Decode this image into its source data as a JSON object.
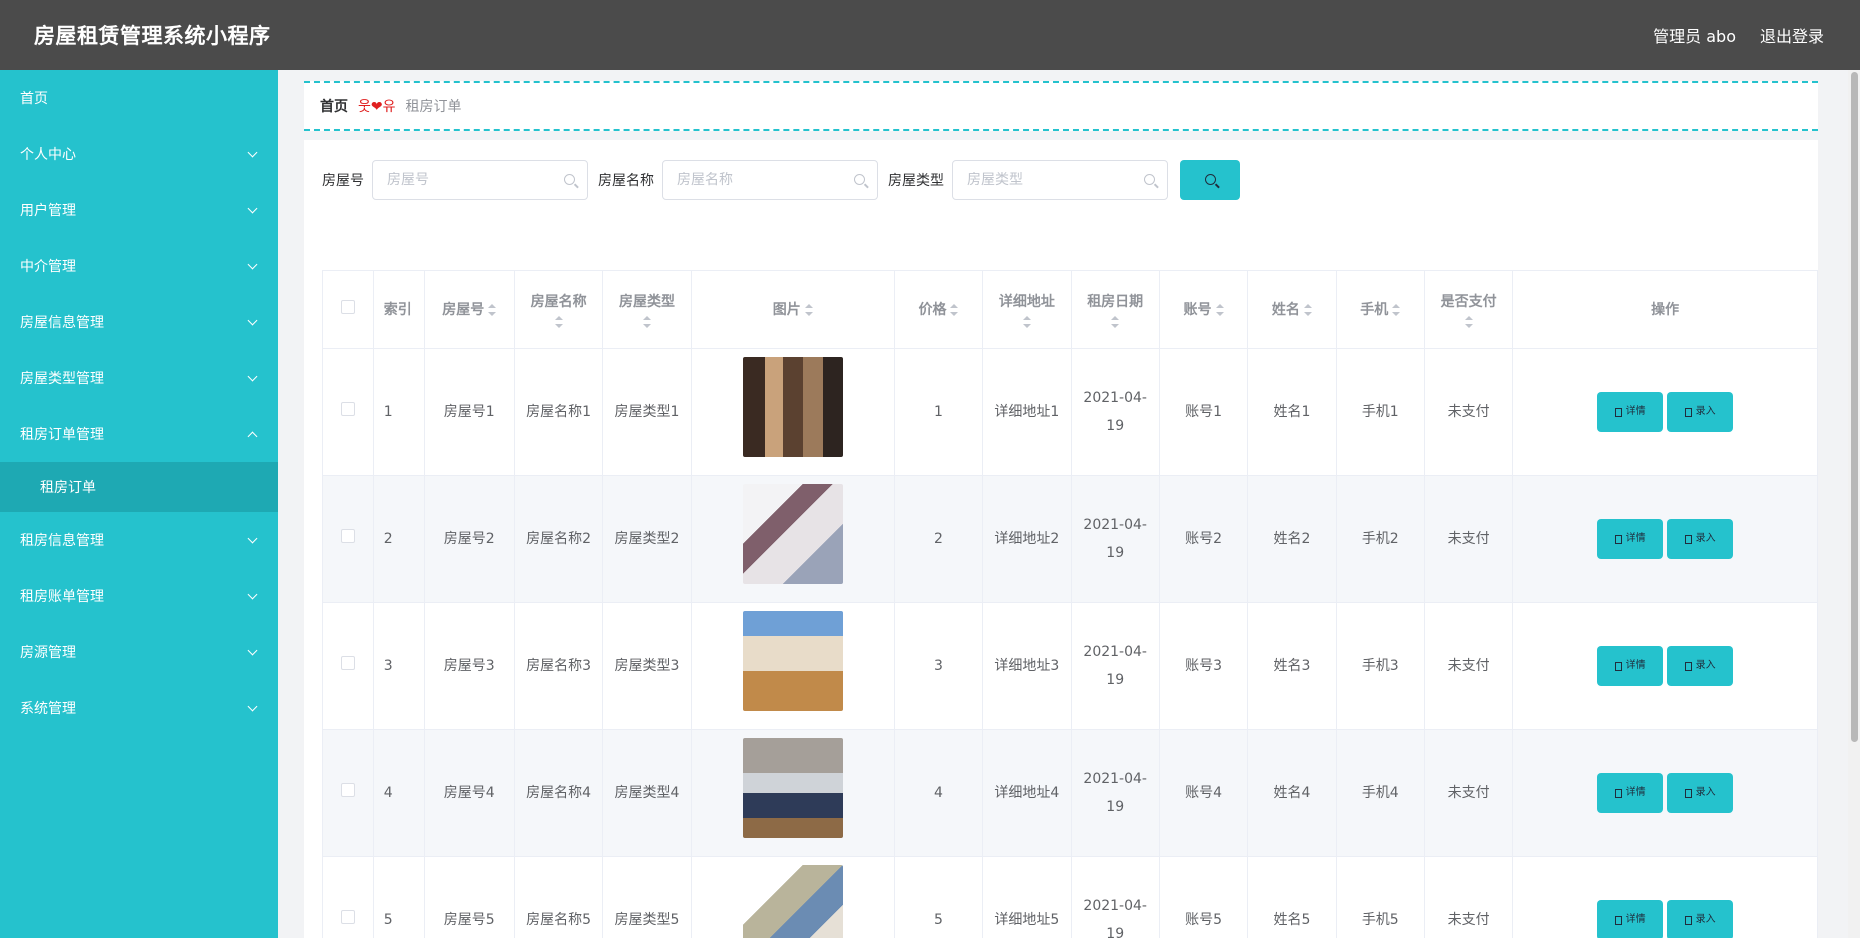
{
  "app": {
    "title": "房屋租赁管理系统小程序"
  },
  "header": {
    "user_label": "管理员 abo",
    "logout_label": "退出登录"
  },
  "sidebar": {
    "items": [
      {
        "label": "首页",
        "expandable": false
      },
      {
        "label": "个人中心",
        "expandable": true
      },
      {
        "label": "用户管理",
        "expandable": true
      },
      {
        "label": "中介管理",
        "expandable": true
      },
      {
        "label": "房屋信息管理",
        "expandable": true
      },
      {
        "label": "房屋类型管理",
        "expandable": true
      },
      {
        "label": "租房订单管理",
        "expandable": true,
        "expanded": true
      },
      {
        "label": "租房信息管理",
        "expandable": true
      },
      {
        "label": "租房账单管理",
        "expandable": true
      },
      {
        "label": "房源管理",
        "expandable": true
      },
      {
        "label": "系统管理",
        "expandable": true
      }
    ],
    "subitem": "租房订单"
  },
  "breadcrumb": {
    "home": "首页",
    "separator": "웃❤유",
    "current": "租房订单"
  },
  "search": {
    "fields": [
      {
        "label": "房屋号",
        "placeholder": "房屋号",
        "value": ""
      },
      {
        "label": "房屋名称",
        "placeholder": "房屋名称",
        "value": ""
      },
      {
        "label": "房屋类型",
        "placeholder": "房屋类型",
        "value": ""
      }
    ]
  },
  "table": {
    "columns": [
      "索引",
      "房屋号",
      "房屋名称",
      "房屋类型",
      "图片",
      "价格",
      "详细地址",
      "租房日期",
      "账号",
      "姓名",
      "手机",
      "是否支付",
      "操作"
    ],
    "rows": [
      {
        "index": "1",
        "house_no": "房屋号1",
        "house_name": "房屋名称1",
        "house_type": "房屋类型1",
        "price": "1",
        "address": "详细地址1",
        "date_a": "2021-04-",
        "date_b": "19",
        "account": "账号1",
        "name": "姓名1",
        "phone": "手机1",
        "paid": "未支付"
      },
      {
        "index": "2",
        "house_no": "房屋号2",
        "house_name": "房屋名称2",
        "house_type": "房屋类型2",
        "price": "2",
        "address": "详细地址2",
        "date_a": "2021-04-",
        "date_b": "19",
        "account": "账号2",
        "name": "姓名2",
        "phone": "手机2",
        "paid": "未支付"
      },
      {
        "index": "3",
        "house_no": "房屋号3",
        "house_name": "房屋名称3",
        "house_type": "房屋类型3",
        "price": "3",
        "address": "详细地址3",
        "date_a": "2021-04-",
        "date_b": "19",
        "account": "账号3",
        "name": "姓名3",
        "phone": "手机3",
        "paid": "未支付"
      },
      {
        "index": "4",
        "house_no": "房屋号4",
        "house_name": "房屋名称4",
        "house_type": "房屋类型4",
        "price": "4",
        "address": "详细地址4",
        "date_a": "2021-04-",
        "date_b": "19",
        "account": "账号4",
        "name": "姓名4",
        "phone": "手机4",
        "paid": "未支付"
      },
      {
        "index": "5",
        "house_no": "房屋号5",
        "house_name": "房屋名称5",
        "house_type": "房屋类型5",
        "price": "5",
        "address": "详细地址5",
        "date_a": "2021-04-",
        "date_b": "19",
        "account": "账号5",
        "name": "姓名5",
        "phone": "手机5",
        "paid": "未支付"
      }
    ],
    "actions": {
      "detail": "详情",
      "entry": "录入"
    }
  },
  "colors": {
    "header_bg": "#4b4b4b",
    "accent": "#25c2cd",
    "accent_dark": "#1ea9b3"
  }
}
